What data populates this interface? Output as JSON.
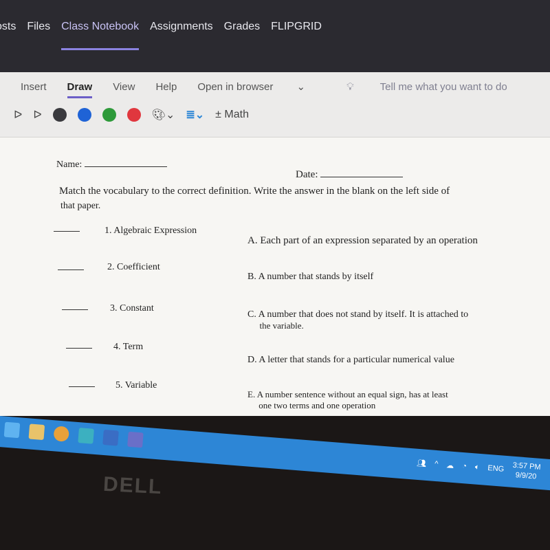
{
  "app_tabs": [
    {
      "label": "osts",
      "active": false
    },
    {
      "label": "Files",
      "active": false
    },
    {
      "label": "Class Notebook",
      "active": true
    },
    {
      "label": "Assignments",
      "active": false
    },
    {
      "label": "Grades",
      "active": false
    },
    {
      "label": "FLIPGRID",
      "active": false
    }
  ],
  "ribbon": {
    "tabs": [
      "Insert",
      "Draw",
      "View",
      "Help"
    ],
    "active_tab": "Draw",
    "open_in_browser": "Open in browser",
    "tell_me": "Tell me what you want to do",
    "math": "Math",
    "pen_colors": [
      "#3a3a3e",
      "#1f63d6",
      "#2e9a3a",
      "#e0373e"
    ]
  },
  "document": {
    "name_label": "Name:",
    "date_label": "Date:",
    "instructions": "Match the vocabulary to the correct definition. Write the answer in the blank on the left side of",
    "instructions_2": "that paper.",
    "terms": [
      "1. Algebraic Expression",
      "2. Coefficient",
      "3. Constant",
      "4. Term",
      "5. Variable"
    ],
    "definitions": [
      {
        "letter": "A.",
        "text": "Each part of an expression separated by an operation"
      },
      {
        "letter": "B.",
        "text": "A number that stands by itself"
      },
      {
        "letter": "C.",
        "text": "A number that does not stand by itself. It is attached to",
        "text2": "the variable."
      },
      {
        "letter": "D.",
        "text": "A letter that stands for a particular numerical value"
      },
      {
        "letter": "E.",
        "text": "A number sentence without an equal sign, has at least",
        "text2": "one two terms and one operation"
      }
    ]
  },
  "taskbar": {
    "lang": "ENG",
    "time": "3:57 PM",
    "date": "9/9/20"
  },
  "bezel_logo": "DELL"
}
